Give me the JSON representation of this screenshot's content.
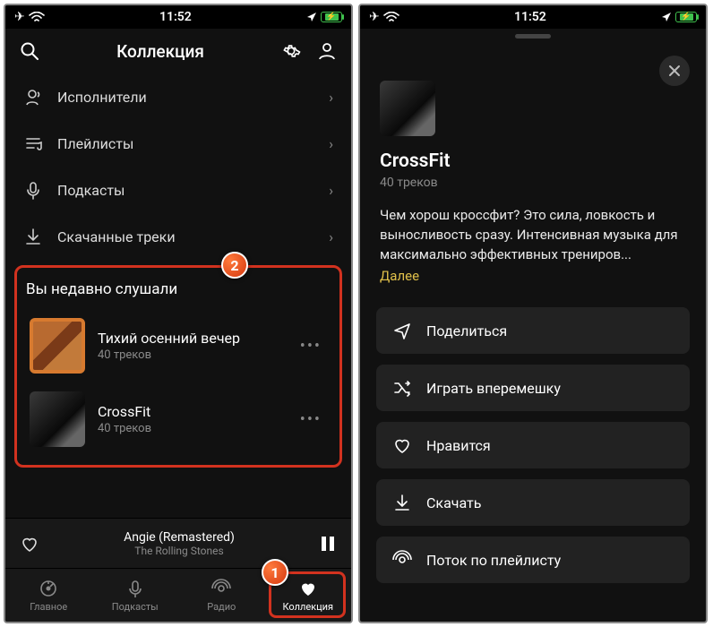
{
  "statusbar": {
    "time": "11:52"
  },
  "header": {
    "title": "Коллекция"
  },
  "nav": {
    "artists": "Исполнители",
    "playlists": "Плейлисты",
    "podcasts": "Подкасты",
    "downloaded": "Скачанные треки"
  },
  "recent": {
    "title": "Вы недавно слушали",
    "items": [
      {
        "title": "Тихий осенний вечер",
        "sub": "40 треков"
      },
      {
        "title": "CrossFit",
        "sub": "40 треков"
      }
    ]
  },
  "nowplaying": {
    "title": "Angie (Remastered)",
    "artist": "The Rolling Stones"
  },
  "tabs": {
    "home": "Главное",
    "podcasts": "Подкасты",
    "radio": "Радио",
    "collection": "Коллекция"
  },
  "detail": {
    "title": "CrossFit",
    "sub": "40 треков",
    "desc": "Чем хорош кроссфит? Это сила, ловкость и выносливость сразу. Интенсивная музыка для максимально эффективных трениров...",
    "more": "Далее"
  },
  "actions": {
    "share": "Поделиться",
    "shuffle": "Играть вперемешку",
    "like": "Нравится",
    "download": "Скачать",
    "stream": "Поток по плейлисту"
  },
  "callouts": {
    "one": "1",
    "two": "2"
  }
}
